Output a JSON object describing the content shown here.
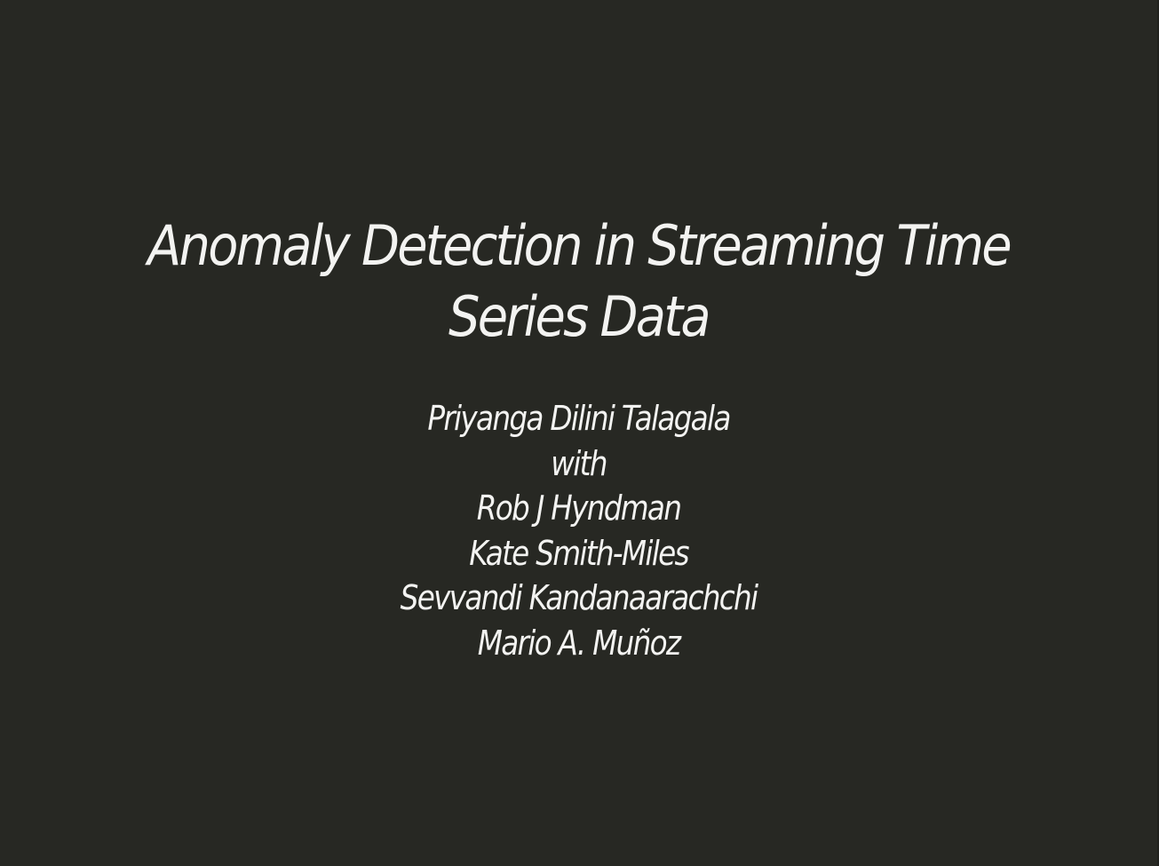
{
  "slide": {
    "title": "Anomaly Detection in Streaming Time Series Data",
    "presenter": "Priyanga Dilini Talagala",
    "connector": "with",
    "coauthors": [
      "Rob J Hyndman",
      "Kate Smith-Miles",
      "Sevvandi Kandanaarachchi",
      "Mario A. Muñoz"
    ],
    "colors": {
      "background": "#272823",
      "text": "#f3f3f1"
    }
  }
}
